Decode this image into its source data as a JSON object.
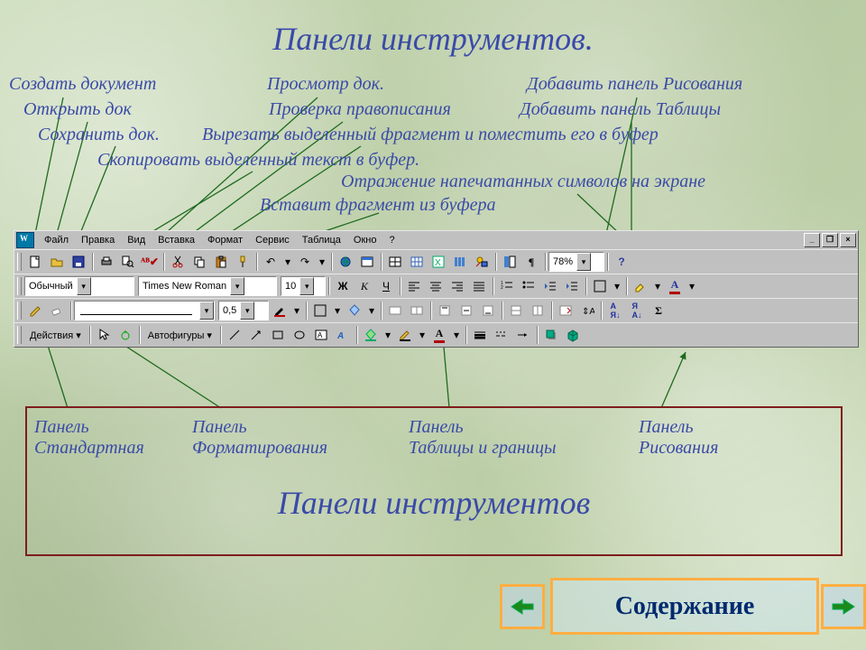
{
  "title": "Панели инструментов.",
  "callouts": {
    "create_doc": "Создать документ",
    "open_doc": "Открыть док",
    "save_doc": "Сохранить док.",
    "copy_text": "Скопировать выделенный текст в буфер.",
    "preview_doc": "Просмотр док.",
    "spellcheck": "Проверка правописания",
    "cut_fragment": "Вырезать выделенный фрагмент и поместить его в буфер",
    "paste_fragment": "Вставит фрагмент из буфера",
    "show_symbols": "Отражение напечатанных символов на экране",
    "add_drawing_panel": "Добавить панель Рисования",
    "add_tables_panel": "Добавить панель Таблицы"
  },
  "menubar": {
    "items": [
      "Файл",
      "Правка",
      "Вид",
      "Вставка",
      "Формат",
      "Сервис",
      "Таблица",
      "Окно",
      "?"
    ]
  },
  "standard": {
    "zoom": "78%"
  },
  "formatting": {
    "style": "Обычный",
    "font": "Times New Roman",
    "size": "10",
    "bold": "Ж",
    "italic": "К",
    "underline": "Ч"
  },
  "tables_borders": {
    "line_width": "0,5"
  },
  "drawing": {
    "actions": "Действия",
    "autoshapes": "Автофигуры"
  },
  "legend": {
    "c1a": "Панель",
    "c1b": "Стандартная",
    "c2a": "Панель",
    "c2b": "Форматирования",
    "c3a": "Панель",
    "c3b": "Таблицы и границы",
    "c4a": "Панель",
    "c4b": "Рисования",
    "big": "Панели инструментов"
  },
  "nav": {
    "toc": "Содержание"
  }
}
